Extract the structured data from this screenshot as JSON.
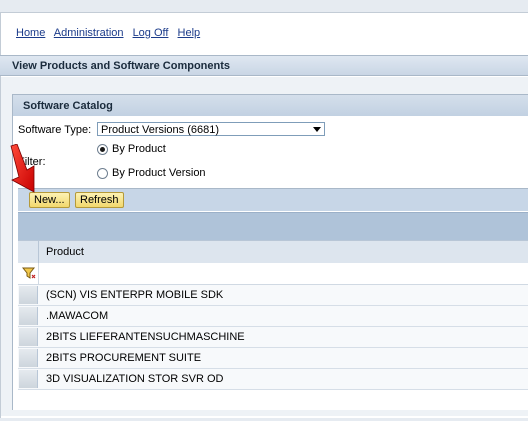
{
  "nav": {
    "home": "Home",
    "administration": "Administration",
    "logoff": "Log Off",
    "help": "Help"
  },
  "page_title": "View Products and Software Components",
  "section_title": "Software Catalog",
  "software_type": {
    "label": "Software Type:",
    "selected": "Product Versions (6681)"
  },
  "filter": {
    "label": "Filter:",
    "options": [
      {
        "label": "By Product",
        "checked": true
      },
      {
        "label": "By Product Version",
        "checked": false
      }
    ]
  },
  "toolbar": {
    "new_label": "New...",
    "refresh_label": "Refresh"
  },
  "table": {
    "column_header": "Product",
    "rows": [
      "(SCN) VIS ENTERPR MOBILE SDK",
      ".MAWACOM",
      "2BITS LIEFERANTENSUCHMASCHINE",
      "2BITS PROCUREMENT SUITE",
      "3D VISUALIZATION STOR SVR OD"
    ]
  },
  "icons": {
    "filter": "filter-funnel-icon",
    "pointer": "red-arrow-annotation-icon"
  },
  "colors": {
    "link": "#1b3b8a",
    "button": "#f2d86e",
    "header": "#c9d6e5",
    "arrow": "#e00000"
  }
}
